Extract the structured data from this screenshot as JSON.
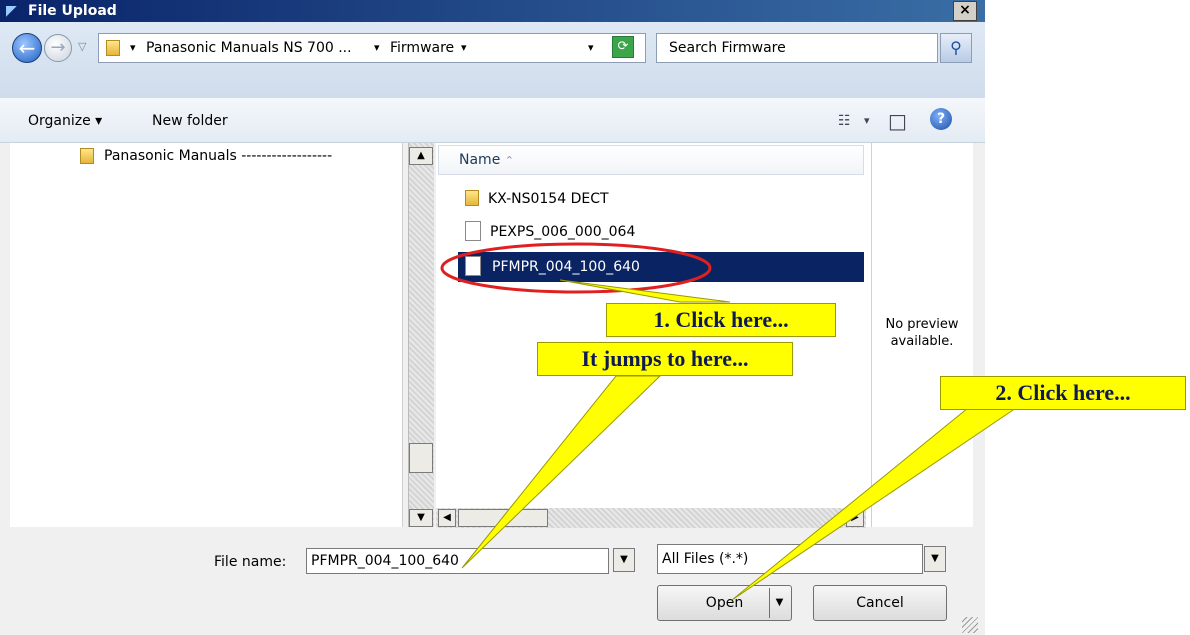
{
  "window": {
    "title": "File Upload",
    "close_label": "×"
  },
  "address": {
    "crumb_sep": "▾",
    "crumbs": [
      "Panasonic Manuals NS 700 ...",
      "Firmware"
    ],
    "dropdown_glyph": "▾",
    "search_placeholder": "Search Firmware"
  },
  "toolbar": {
    "organize_label": "Organize ▾",
    "new_folder_label": "New folder",
    "view_glyph": "☷",
    "view_dd": "▾",
    "pane_glyph": "□",
    "help_glyph": "?"
  },
  "nav": {
    "item_label": "Panasonic Manuals ------------------"
  },
  "files": {
    "column_name": "Name",
    "sort_glyph": "⌃",
    "items": [
      {
        "name": "KX-NS0154 DECT",
        "type": "folder"
      },
      {
        "name": "PEXPS_006_000_064",
        "type": "file"
      },
      {
        "name": "PFMPR_004_100_640",
        "type": "file",
        "selected": true
      }
    ]
  },
  "preview": {
    "line1": "No preview",
    "line2": "available."
  },
  "bottom": {
    "filename_label": "File name:",
    "filename_value": "PFMPR_004_100_640",
    "filter_value": "All Files (*.*)",
    "open_label": "Open",
    "cancel_label": "Cancel",
    "dd_glyph": "▼"
  },
  "annotations": {
    "click1": "1. Click here...",
    "jumps": "It jumps to here...",
    "click2": "2. Click here..."
  },
  "colors": {
    "selection": "#0a2463",
    "callout": "#ffff00",
    "highlight_ring": "#e02020"
  }
}
